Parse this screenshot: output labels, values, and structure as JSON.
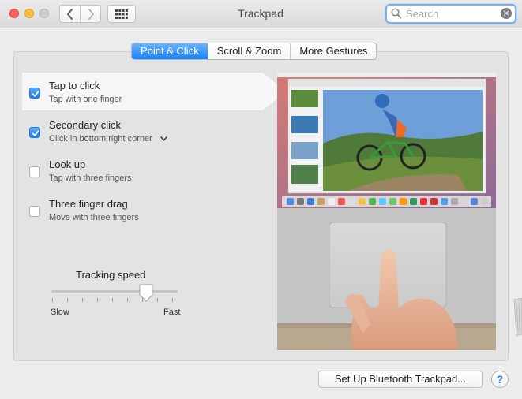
{
  "window": {
    "title": "Trackpad"
  },
  "toolbar": {
    "back_icon": "chevron-left-icon",
    "forward_icon": "chevron-right-icon",
    "show_all_icon": "grid-icon"
  },
  "search": {
    "placeholder": "Search",
    "value": ""
  },
  "tabs": [
    {
      "label": "Point & Click",
      "active": true
    },
    {
      "label": "Scroll & Zoom",
      "active": false
    },
    {
      "label": "More Gestures",
      "active": false
    }
  ],
  "options": [
    {
      "title": "Tap to click",
      "subtitle": "Tap with one finger",
      "checked": true,
      "selected": true
    },
    {
      "title": "Secondary click",
      "subtitle": "Click in bottom right corner",
      "checked": true,
      "has_dropdown": true
    },
    {
      "title": "Look up",
      "subtitle": "Tap with three fingers",
      "checked": false
    },
    {
      "title": "Three finger drag",
      "subtitle": "Move with three fingers",
      "checked": false
    }
  ],
  "tracking": {
    "label": "Tracking speed",
    "min_label": "Slow",
    "max_label": "Fast",
    "value_fraction": 0.75
  },
  "buttons": {
    "setup": "Set Up Bluetooth Trackpad...",
    "help": "?"
  },
  "colors": {
    "accent": "#1a82fb",
    "checkbox_on": "#1a7ff5"
  }
}
